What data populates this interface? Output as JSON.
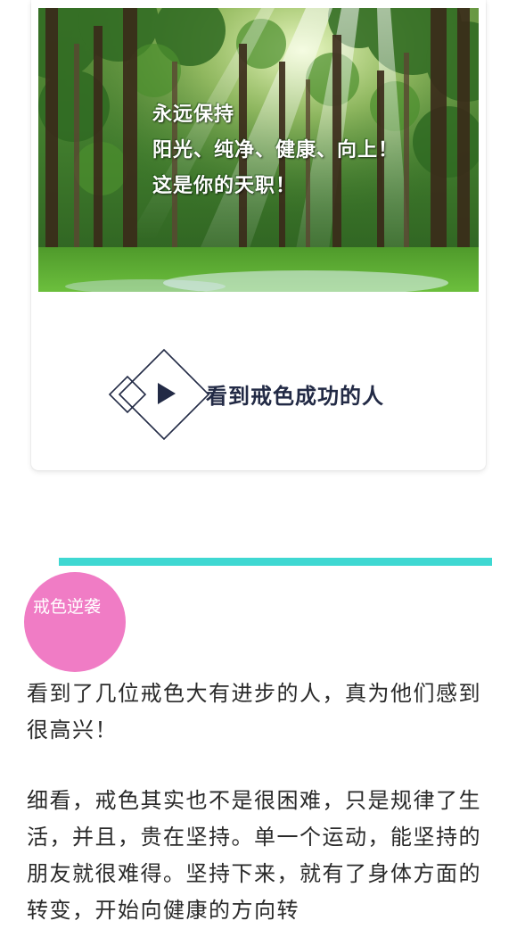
{
  "hero": {
    "lines": [
      "永远保持",
      "阳光、纯净、健康、向上！",
      "这是你的天职！"
    ]
  },
  "section": {
    "play_icon": "play-triangle-icon",
    "title": "看到戒色成功的人"
  },
  "badge": {
    "label": "戒色逆袭",
    "color": "#f07cc5"
  },
  "divider_color": "#3fd8d2",
  "article": {
    "paragraphs": [
      "看到了几位戒色大有进步的人，真为他们感到很高兴！",
      "细看，戒色其实也不是很困难，只是规律了生活，并且，贵在坚持。单一个运动，能坚持的朋友就很难得。坚持下来，就有了身体方面的转变，开始向健康的方向转"
    ]
  }
}
